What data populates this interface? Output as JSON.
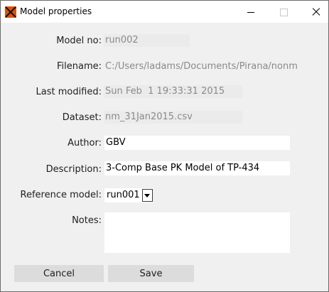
{
  "window": {
    "title": "Model properties",
    "icon": "pirana-app-icon",
    "controls": [
      "minimize-icon",
      "maximize-icon",
      "close-icon"
    ]
  },
  "form": {
    "model_no": {
      "label": "Model no:",
      "value": "run002"
    },
    "filename": {
      "label": "Filename:",
      "value": "C:/Users/ladams/Documents/Pirana/nonm"
    },
    "last_modified": {
      "label": "Last modified:",
      "value": "Sun Feb  1 19:33:31 2015"
    },
    "dataset": {
      "label": "Dataset:",
      "value": "nm_31Jan2015.csv"
    },
    "author": {
      "label": "Author:",
      "value": "GBV"
    },
    "description": {
      "label": "Description:",
      "value": "3-Comp Base PK Model of TP-434"
    },
    "reference_model": {
      "label": "Reference model:",
      "value": "run001"
    },
    "notes": {
      "label": "Notes:",
      "value": ""
    }
  },
  "buttons": {
    "cancel": "Cancel",
    "save": "Save"
  }
}
